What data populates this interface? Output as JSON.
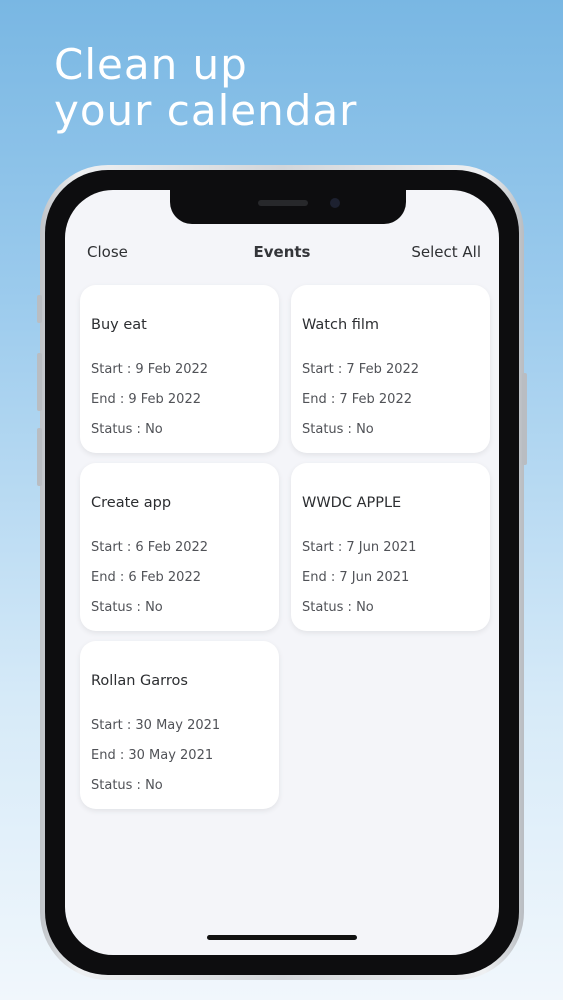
{
  "headline": {
    "line1": "Clean up",
    "line2": "your calendar"
  },
  "navbar": {
    "close_label": "Close",
    "title": "Events",
    "select_all_label": "Select All"
  },
  "events": [
    {
      "title": "Buy eat",
      "start": "Start : 9 Feb 2022",
      "end": "End : 9 Feb 2022",
      "status": "Status : No"
    },
    {
      "title": "Watch film",
      "start": "Start : 7 Feb 2022",
      "end": "End : 7 Feb 2022",
      "status": "Status : No"
    },
    {
      "title": "Create app",
      "start": "Start : 6 Feb 2022",
      "end": "End : 6 Feb 2022",
      "status": "Status : No"
    },
    {
      "title": "WWDC APPLE",
      "start": "Start : 7 Jun 2021",
      "end": "End : 7 Jun 2021",
      "status": "Status : No"
    },
    {
      "title": "Rollan Garros",
      "start": "Start : 30 May 2021",
      "end": "End : 30 May 2021",
      "status": "Status : No"
    }
  ],
  "colors": {
    "background_top": "#79b7e3",
    "background_bottom": "#f1f7fc",
    "screen": "#f4f5f9",
    "card": "#ffffff"
  }
}
